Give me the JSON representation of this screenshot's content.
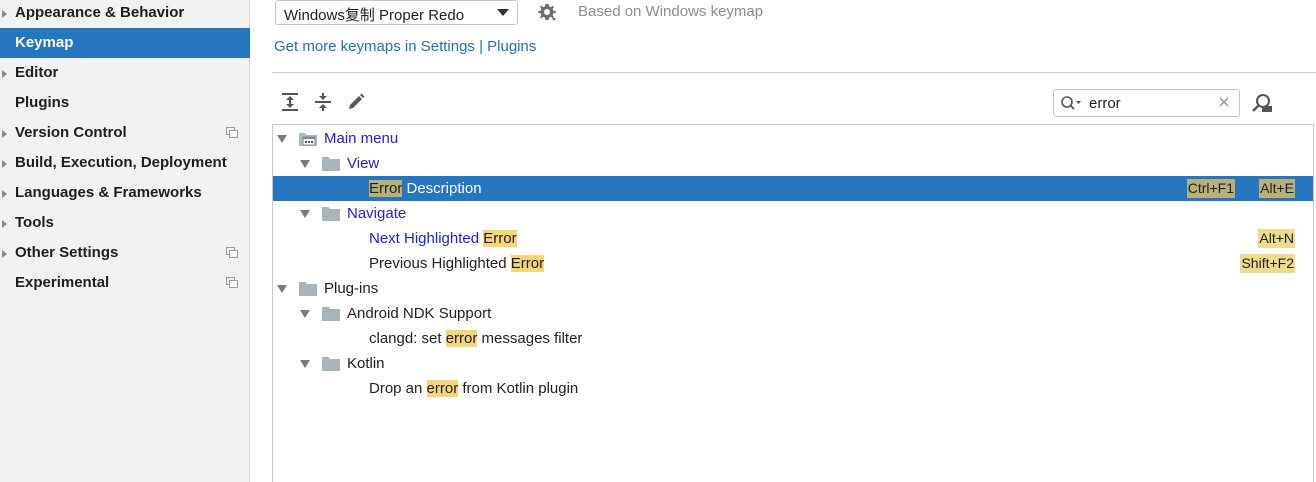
{
  "sidebar": {
    "items": [
      {
        "label": "Appearance & Behavior",
        "expandable": true,
        "project_icon": false
      },
      {
        "label": "Keymap",
        "expandable": false,
        "project_icon": false,
        "selected": true
      },
      {
        "label": "Editor",
        "expandable": true,
        "project_icon": false
      },
      {
        "label": "Plugins",
        "expandable": false,
        "project_icon": false
      },
      {
        "label": "Version Control",
        "expandable": true,
        "project_icon": true
      },
      {
        "label": "Build, Execution, Deployment",
        "expandable": true,
        "project_icon": false
      },
      {
        "label": "Languages & Frameworks",
        "expandable": true,
        "project_icon": false
      },
      {
        "label": "Tools",
        "expandable": true,
        "project_icon": false
      },
      {
        "label": "Other Settings",
        "expandable": true,
        "project_icon": true
      },
      {
        "label": "Experimental",
        "expandable": false,
        "project_icon": true
      }
    ]
  },
  "keymap": {
    "selected": "Windows复制 Proper Redo",
    "based_on": "Based on Windows keymap",
    "more_link": "Get more keymaps in Settings | Plugins"
  },
  "toolbar": {
    "icons": [
      "expand-all-icon",
      "collapse-all-icon",
      "edit-icon"
    ]
  },
  "search": {
    "value": "error"
  },
  "tree": {
    "rows": [
      {
        "parts": [
          {
            "t": "Main menu"
          }
        ],
        "color": "blue",
        "expanded": true,
        "icon": "main-menu",
        "level": 0
      },
      {
        "parts": [
          {
            "t": "View"
          }
        ],
        "color": "blue",
        "expanded": true,
        "icon": "folder",
        "level": 1
      },
      {
        "parts": [
          {
            "t": "Error",
            "hl": true
          },
          {
            "t": " Description"
          }
        ],
        "color": "normal",
        "level": 2,
        "selected": true,
        "shortcuts": [
          "Ctrl+F1",
          "Alt+E"
        ]
      },
      {
        "parts": [
          {
            "t": "Navigate"
          }
        ],
        "color": "blue",
        "expanded": true,
        "icon": "folder",
        "level": 1
      },
      {
        "parts": [
          {
            "t": "Next Highlighted "
          },
          {
            "t": "Error",
            "hl": true
          }
        ],
        "color": "blue",
        "level": 2,
        "shortcuts": [
          "Alt+N"
        ]
      },
      {
        "parts": [
          {
            "t": "Previous Highlighted "
          },
          {
            "t": "Error",
            "hl": true
          }
        ],
        "color": "normal",
        "level": 2,
        "shortcuts": [
          "Shift+F2"
        ]
      },
      {
        "parts": [
          {
            "t": "Plug-ins"
          }
        ],
        "color": "normal",
        "expanded": true,
        "icon": "folder",
        "level": 0
      },
      {
        "parts": [
          {
            "t": "Android NDK Support"
          }
        ],
        "color": "normal",
        "expanded": true,
        "icon": "folder",
        "level": 1
      },
      {
        "parts": [
          {
            "t": "clangd: set "
          },
          {
            "t": "error",
            "hl": true
          },
          {
            "t": " messages filter"
          }
        ],
        "color": "normal",
        "level": 2
      },
      {
        "parts": [
          {
            "t": "Kotlin"
          }
        ],
        "color": "normal",
        "expanded": true,
        "icon": "folder",
        "level": 1
      },
      {
        "parts": [
          {
            "t": "Drop an "
          },
          {
            "t": "error",
            "hl": true
          },
          {
            "t": " from Kotlin plugin"
          }
        ],
        "color": "normal",
        "level": 2
      }
    ]
  },
  "colors": {
    "selection": "#2675bf",
    "link": "#2470b3",
    "action_blue": "#1f1fd1",
    "highlight": "#f7d67a"
  }
}
